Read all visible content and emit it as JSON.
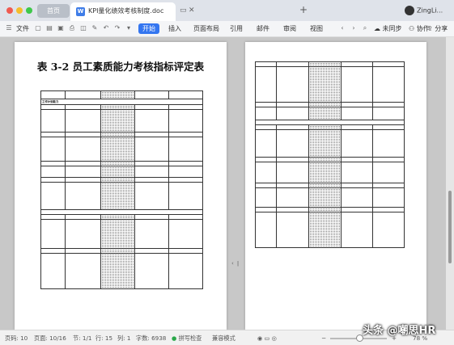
{
  "tabs": {
    "home": "首页",
    "document": "KPI量化绩效考核制度.doc",
    "new_tab": "+"
  },
  "user": {
    "name": "ZingLi..."
  },
  "menu": {
    "file": "文件",
    "start": "开始",
    "insert": "插入",
    "layout": "页面布局",
    "reference": "引用",
    "mail": "邮件",
    "review": "审阅",
    "view": "视图",
    "unsynced": "未同步",
    "collab": "协作",
    "share": "分享"
  },
  "document": {
    "title": "表 3-2  员工素质能力考核指标评定表",
    "left_header": [
      "",
      "",
      "",
      "",
      ""
    ],
    "left_sections": [
      {
        "name": "工作计划能力",
        "rows": [
          {
            "label": "",
            "cells": [
              "",
              "",
              "",
              "",
              ""
            ]
          }
        ]
      },
      {
        "name": "",
        "rows": []
      }
    ]
  },
  "statusbar": {
    "page": "页码: 10",
    "pages": "页面: 10/16",
    "section": "节: 1/1",
    "line": "行: 15",
    "column": "列: 1",
    "wordcount": "字数: 6938",
    "spellcheck": "拼写检查",
    "compat": "兼容模式",
    "zoom": "78 %"
  },
  "watermark": "头条 @嘲思HR"
}
